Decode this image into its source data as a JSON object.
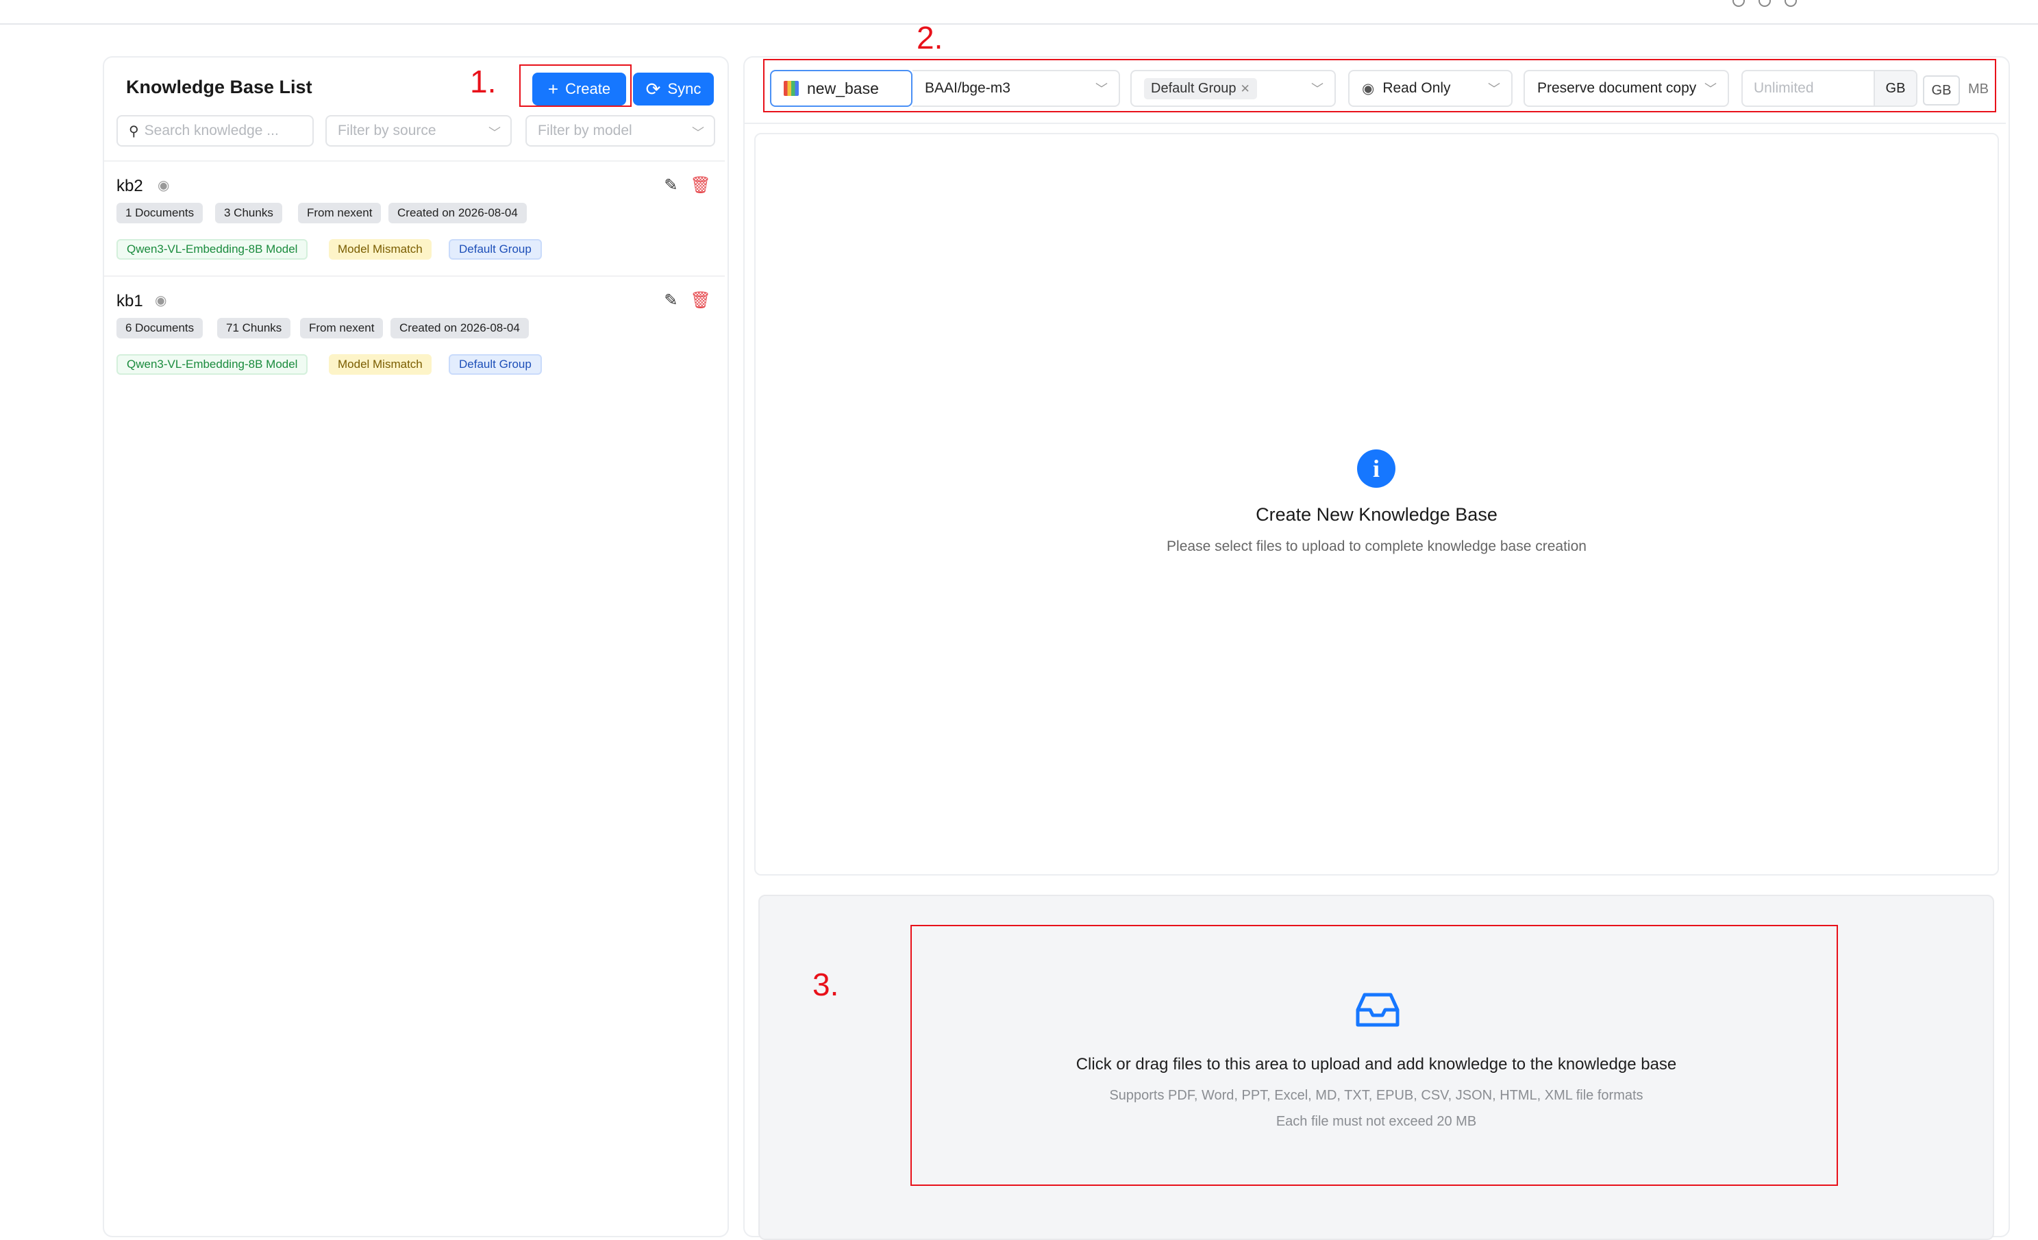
{
  "left": {
    "title": "Knowledge Base List",
    "create_label": "Create",
    "sync_label": "Sync",
    "search_placeholder": "Search knowledge ...",
    "source_placeholder": "Filter by source",
    "model_placeholder": "Filter by model",
    "items": [
      {
        "name": "kb2",
        "documents": "1 Documents",
        "chunks": "3 Chunks",
        "source": "From nexent",
        "created": "Created on 2026-08-04",
        "model": "Qwen3-VL-Embedding-8B Model",
        "mismatch": "Model Mismatch",
        "group": "Default Group"
      },
      {
        "name": "kb1",
        "documents": "6 Documents",
        "chunks": "71 Chunks",
        "source": "From nexent",
        "created": "Created on 2026-08-04",
        "model": "Qwen3-VL-Embedding-8B Model",
        "mismatch": "Model Mismatch",
        "group": "Default Group"
      }
    ]
  },
  "config": {
    "name_value": "new_base",
    "model_value": "BAAI/bge-m3",
    "group_value": "Default Group",
    "access_value": "Read Only",
    "preserve_value": "Preserve document copy",
    "size_placeholder": "Unlimited",
    "size_unit": "GB",
    "unit_options": [
      "GB",
      "MB"
    ]
  },
  "main": {
    "title": "Create New Knowledge Base",
    "subtitle": "Please select files to upload to complete knowledge base creation"
  },
  "upload": {
    "title": "Click or drag files to this area to upload and add knowledge to the knowledge base",
    "formats": "Supports PDF, Word, PPT, Excel, MD, TXT, EPUB, CSV, JSON, HTML, XML file formats",
    "limit": "Each file must not exceed 20 MB"
  },
  "annotations": [
    "1.",
    "2.",
    "3."
  ],
  "colors": {
    "primary": "#1677ff",
    "annotation": "#e8111a",
    "delete": "#e5484d"
  }
}
